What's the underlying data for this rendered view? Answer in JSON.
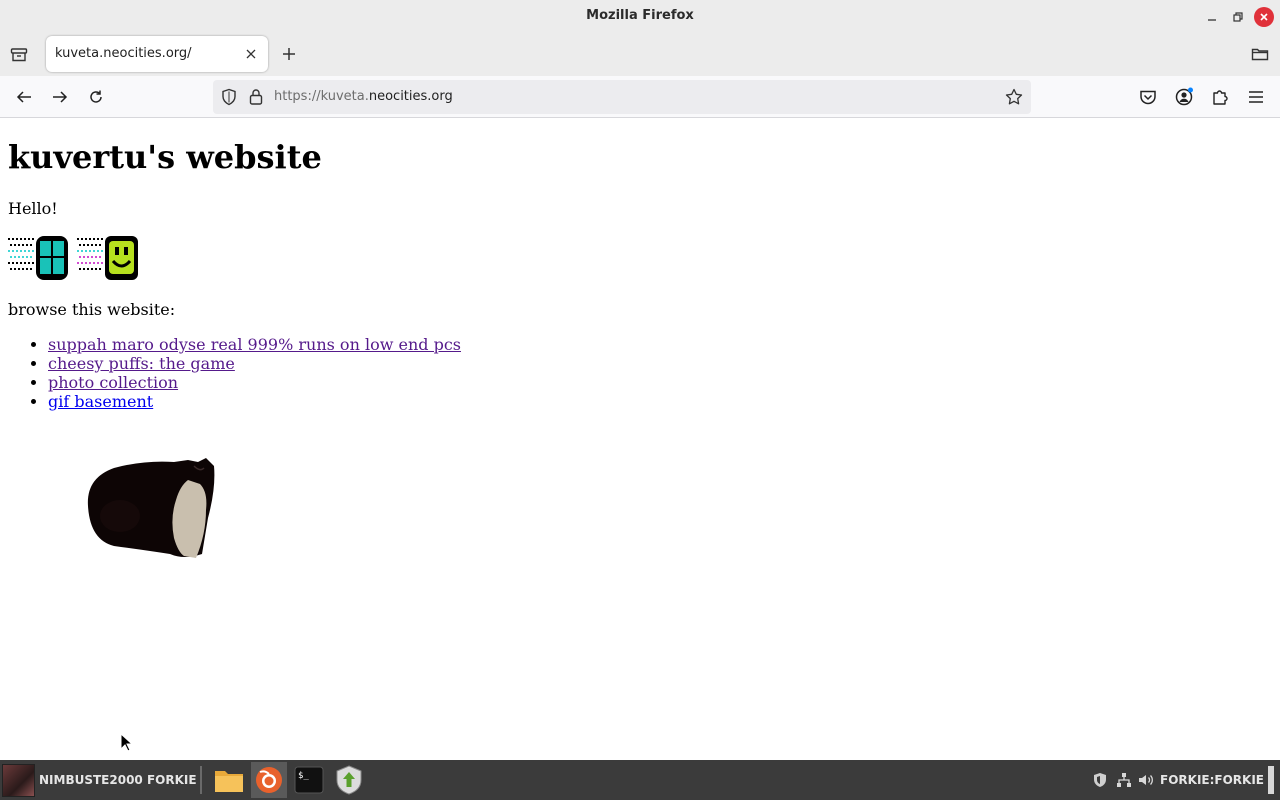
{
  "window": {
    "title": "Mozilla Firefox"
  },
  "tabs": [
    {
      "title": "kuveta.neocities.org/",
      "active": true
    }
  ],
  "navbar": {
    "url_prefix": "https://kuveta.",
    "url_domain": "neocities.org"
  },
  "page": {
    "heading": "kuvertu's website",
    "greeting": "Hello!",
    "browse_label": "browse this website:",
    "links": [
      {
        "label": "suppah maro odyse real 999% runs on low end pcs",
        "visited": true
      },
      {
        "label": "cheesy puffs: the game",
        "visited": true
      },
      {
        "label": "photo collection",
        "visited": true
      },
      {
        "label": "gif basement",
        "visited": false
      }
    ],
    "colors": {
      "visited_link": "#551a8b",
      "unvisited_link": "#0000ee"
    }
  },
  "taskbar": {
    "user_label": "NIMBUSTE2000 FORKIE",
    "host_label": "FORKIE:FORKIE",
    "apps": [
      "files-icon",
      "firefox-icon",
      "terminal-icon",
      "update-manager-icon"
    ]
  }
}
